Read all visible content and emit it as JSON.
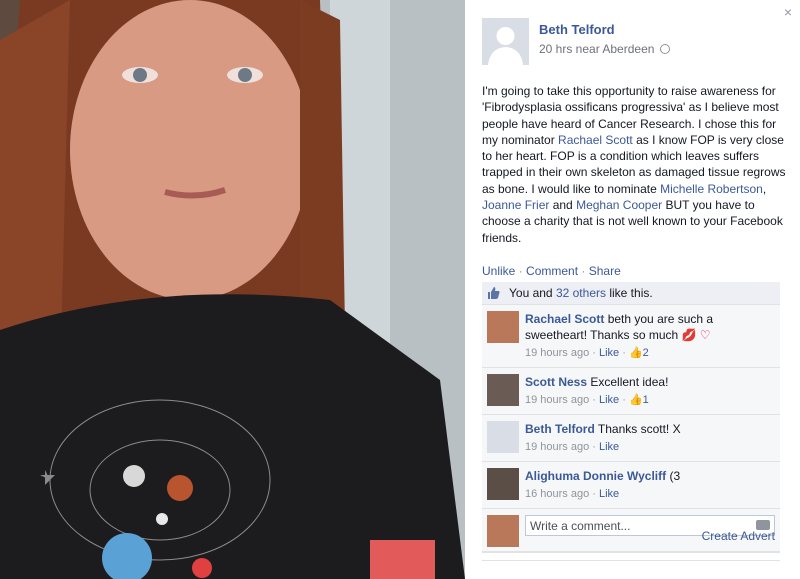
{
  "panel": {
    "close_label": "×",
    "owner_name": "Beth Telford",
    "owner_meta": "20 hrs near Aberdeen",
    "post_parts": [
      {
        "text": "I'm going to take this opportunity to raise awareness for 'Fibrodysplasia ossificans progressiva' as I believe most people have heard of Cancer Research. I chose this for my nominator ",
        "link": false
      },
      {
        "text": "Rachael Scott",
        "link": true
      },
      {
        "text": " as I know FOP is very close to her heart. FOP is a condition which leaves suffers trapped in their own skeleton as damaged tissue regrows as bone. I would like to nominate ",
        "link": false
      },
      {
        "text": "Michelle Robertson",
        "link": true
      },
      {
        "text": ", ",
        "link": false
      },
      {
        "text": "Joanne Frier",
        "link": true
      },
      {
        "text": " and ",
        "link": false
      },
      {
        "text": "Meghan Cooper",
        "link": true
      },
      {
        "text": " BUT you have to choose a charity that is not well known to your Facebook friends.",
        "link": false
      }
    ],
    "actions": {
      "like": "Unlike",
      "comment": "Comment",
      "share": "Share",
      "sep": " · "
    },
    "likes": {
      "prefix": "You and ",
      "others": "32 others",
      "suffix": " like this."
    },
    "comments": [
      {
        "name": "Rachael Scott",
        "text": " beth you are such a sweetheart! Thanks so much ",
        "emoji": "💋 ♡",
        "time": "19 hours ago",
        "like": "Like",
        "likes": "2",
        "avatar_color": "#b9785a"
      },
      {
        "name": "Scott Ness",
        "text": " Excellent idea!",
        "emoji": "",
        "time": "19 hours ago",
        "like": "Like",
        "likes": "1",
        "avatar_color": "#6b5b55"
      },
      {
        "name": "Beth Telford",
        "text": " Thanks scott! X",
        "emoji": "",
        "time": "19 hours ago",
        "like": "Like",
        "likes": "",
        "avatar_color": "#d9dde6"
      },
      {
        "name": "Alighuma Donnie Wycliff",
        "text": " (3",
        "emoji": "",
        "time": "16 hours ago",
        "like": "Like",
        "likes": "",
        "avatar_color": "#5a4e46"
      }
    ],
    "write_placeholder": "Write a comment...",
    "advert": "Create Advert"
  },
  "colors": {
    "link": "#3b5998",
    "ufi_bg": "#f6f7f8",
    "likes_bg": "#edeff4"
  },
  "icons": {
    "close": "close-icon",
    "globe": "globe-icon",
    "thumb": "thumbs-up-icon",
    "camera": "camera-icon"
  }
}
